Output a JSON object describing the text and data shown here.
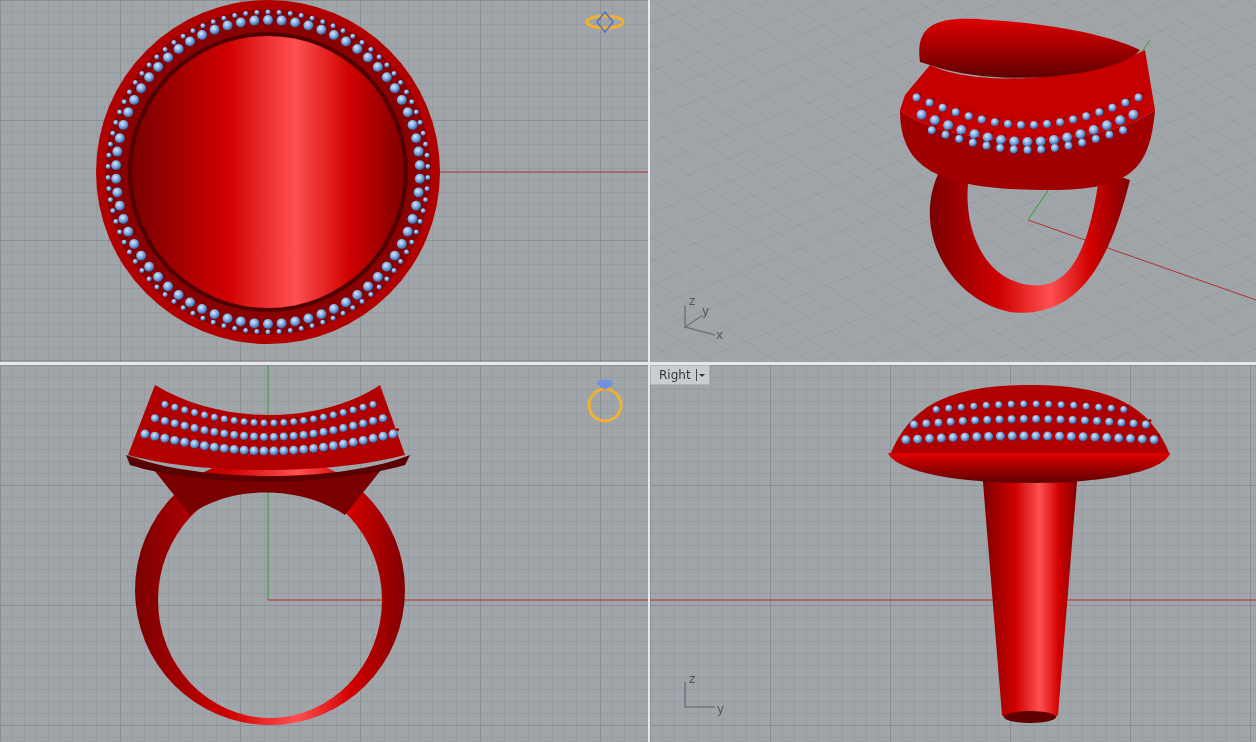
{
  "viewports": [
    {
      "kind": "top"
    },
    {
      "kind": "perspective",
      "axes": [
        "z",
        "y",
        "x"
      ]
    },
    {
      "kind": "front"
    },
    {
      "kind": "right",
      "label": "Right",
      "axes": [
        "z",
        "y"
      ]
    }
  ]
}
